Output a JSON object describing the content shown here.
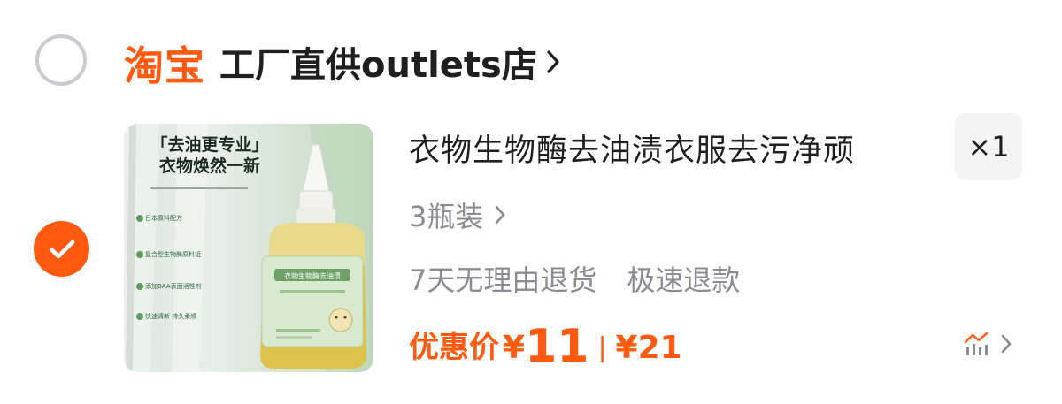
{
  "shop": {
    "platform": "淘宝",
    "name": "工厂直供outlets店",
    "selected": false
  },
  "item": {
    "selected": true,
    "image": {
      "headline_line1": "「去油更专业」",
      "headline_line2": "衣物焕然一新",
      "features": [
        "日本原料配方",
        "复合型生物酶原料组",
        "添加BAA表面活性剂",
        "快速清新 持久柔顺"
      ],
      "bottle_label": "衣物生物酶去油渍"
    },
    "title": "衣物生物酶去油渍衣服去污净顽",
    "quantity": "×1",
    "spec": "3瓶装",
    "services": [
      "7天无理由退货",
      "极速退款"
    ],
    "price": {
      "label": "优惠价",
      "currency": "¥",
      "discounted": "11",
      "separator": "|",
      "original": "¥21"
    }
  },
  "colors": {
    "accent": "#ff5a0f",
    "muted_text": "#8a8c91",
    "radio_border": "#c9cbd0",
    "qty_bg": "#f4f4f5"
  },
  "icons": {
    "shop_arrow": "chevron-right-icon",
    "spec_arrow": "chevron-right-icon",
    "check": "check-icon",
    "price_trend": "price-trend-icon"
  }
}
